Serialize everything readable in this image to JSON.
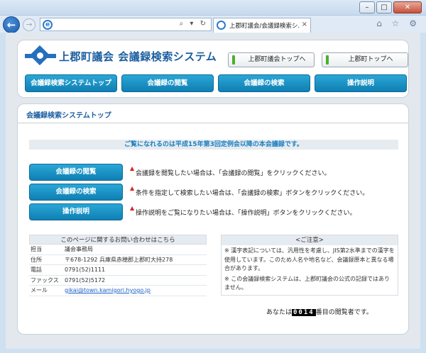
{
  "window": {
    "minimize": "–",
    "maximize": "□",
    "close": "✕"
  },
  "browser": {
    "address": "",
    "address_tools": "⌕ ▾ ↻",
    "tab_title": "上郡町議会/会議録検索シ...",
    "tab_close": "×",
    "back": "←",
    "forward": "→",
    "right_tools": "⌂ ☆ ⚙"
  },
  "header": {
    "title": "上郡町議会  会議録検索システム",
    "link_council": "上郡町議会トップへ",
    "link_town": "上郡町トップへ"
  },
  "nav": [
    {
      "label": "会議録検索システムトップ"
    },
    {
      "label": "会議録の閲覧"
    },
    {
      "label": "会議録の検索"
    },
    {
      "label": "操作説明"
    }
  ],
  "content": {
    "breadcrumb": "会議録検索システムトップ",
    "notice": "ご覧になれるのは平成15年第3回定例会以降の本会議録です。",
    "actions": [
      {
        "label": "会議録の閲覧",
        "mark": "▲",
        "desc": "会議録を閲覧したい場合は、「会議録の閲覧」をクリックください。"
      },
      {
        "label": "会議録の検索",
        "mark": "▲",
        "desc": "条件を指定して検索したい場合は、「会議録の検索」ボタンをクリックください。"
      },
      {
        "label": "操作説明",
        "mark": "▲",
        "desc": "操作説明をご覧になりたい場合は、「操作説明」ボタンをクリックください。"
      }
    ]
  },
  "contact": {
    "heading": "このページに関するお問い合わせはこちら",
    "rows": [
      {
        "key": "担当",
        "value": "議会事務局"
      },
      {
        "key": "住所",
        "value": "〒678-1292 兵庫県赤穂郡上郡町大持278"
      },
      {
        "key": "電話",
        "value": "0791(52)1111"
      },
      {
        "key": "ファックス",
        "value": "0791(52)5172"
      },
      {
        "key": "メール",
        "value": "gikai@town.kamigori.hyogo.jp"
      }
    ]
  },
  "caution": {
    "heading": "<ご注意>",
    "line1": "※ 漢字表記については、汎用性を考慮し、JIS第2水準までの漢字を使用しています。このため人名や地名など、会議録原本と異なる場合があります。",
    "line2": "※ この会議録検索システムは、上郡町議会の公式の記録ではありません。"
  },
  "counter": {
    "prefix": "あなたは",
    "digits": "0014",
    "suffix": "番目の閲覧者です。"
  }
}
